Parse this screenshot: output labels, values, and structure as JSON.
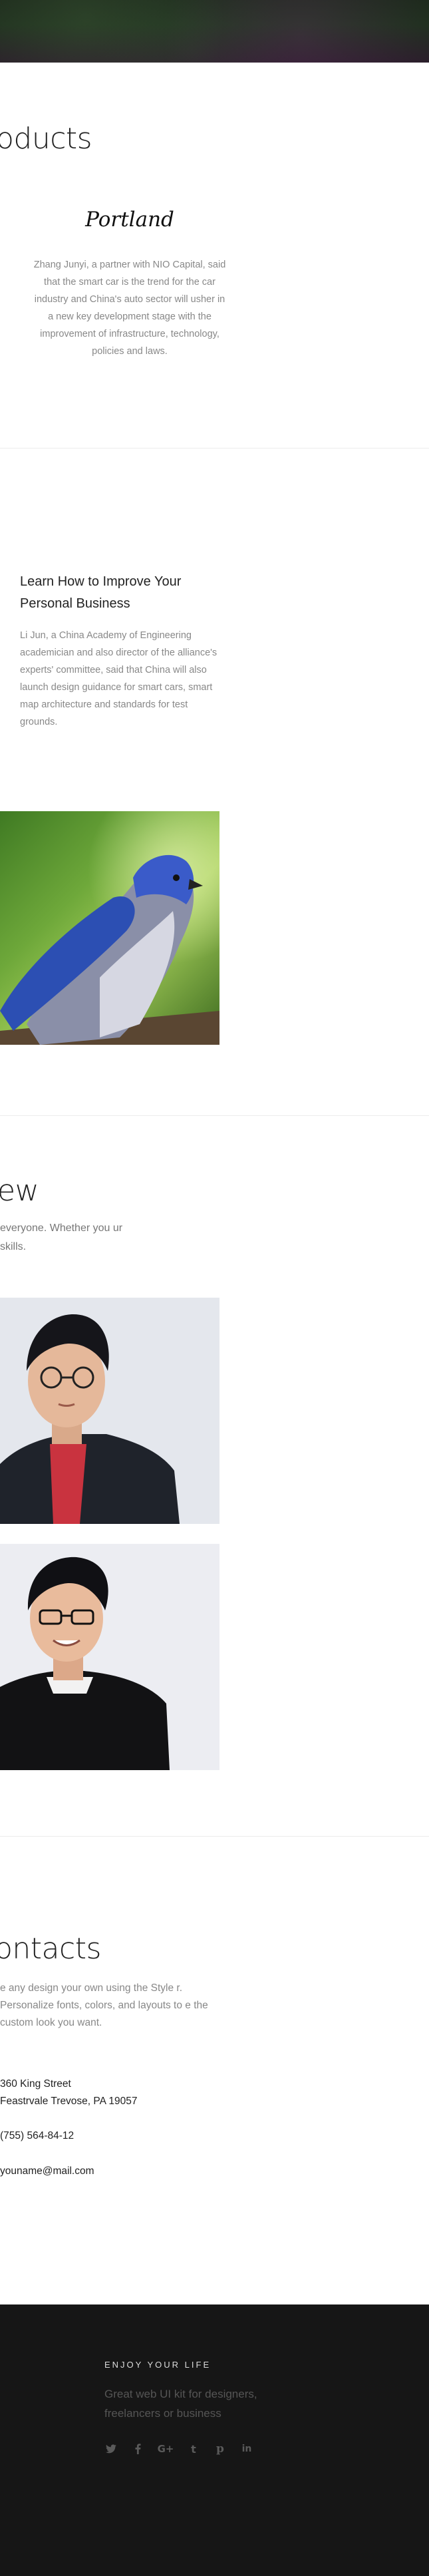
{
  "products": {
    "title": "oducts",
    "card_title": "Portland",
    "card_text": "Zhang Junyi, a partner with NIO Capital, said that the smart car is the trend for the car industry and China's auto sector will usher in a new key development stage with the improvement of infrastructure, technology, policies and laws."
  },
  "blog": {
    "heading": "Learn How to Improve Your Personal Business",
    "text": "Li Jun, a China Academy of Engineering academician and also director of the alliance's experts' committee, said that China will also launch design guidance for smart cars, smart map architecture and standards for test grounds."
  },
  "team": {
    "title": "ew",
    "intro": "everyone. Whether you ur skills."
  },
  "contacts": {
    "title": "ontacts",
    "intro": "e any design your own using the Style r. Personalize fonts, colors, and layouts to e the custom look you want.",
    "address_line1": "360 King Street",
    "address_line2": "Feastrvale Trevose, PA 19057",
    "phone": "(755) 564-84-12",
    "email": "youname@mail.com"
  },
  "footer": {
    "kicker": "ENJOY YOUR LIFE",
    "tagline": "Great web UI kit for designers, freelancers or business",
    "social": [
      "twitter-icon",
      "facebook-icon",
      "google-plus-icon",
      "tumblr-icon",
      "pinterest-icon",
      "linkedin-icon"
    ]
  },
  "colors": {
    "footer_bg": "#161616",
    "text_muted": "#888888",
    "heading": "#222222"
  }
}
